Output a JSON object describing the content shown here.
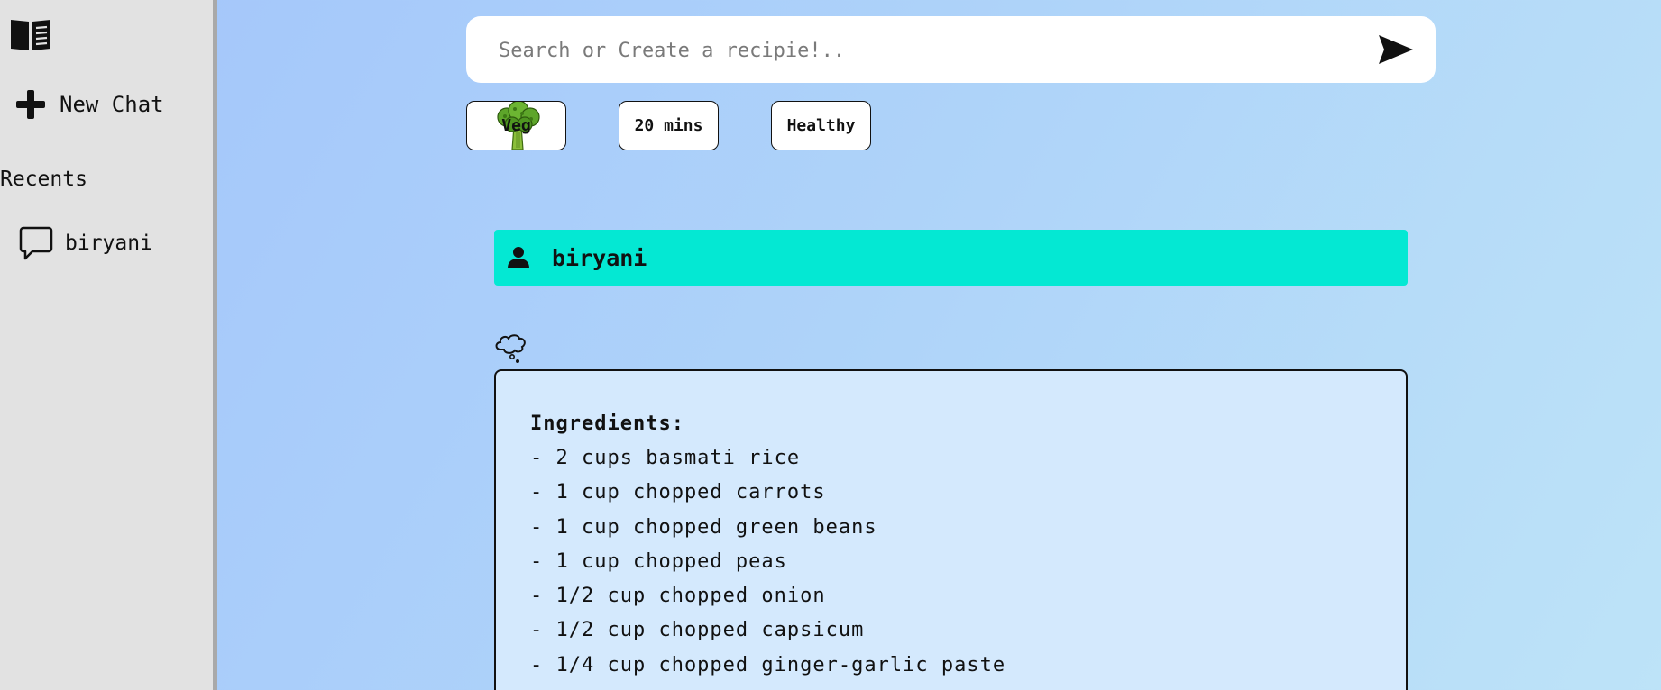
{
  "sidebar": {
    "logo_icon": "open-book-icon",
    "new_chat_label": "New Chat",
    "recents_title": "Recents",
    "recents": [
      {
        "label": "biryani",
        "icon": "chat-bubble-icon"
      }
    ]
  },
  "search": {
    "placeholder": "Search or Create a recipie!..",
    "value": "",
    "send_icon": "send-arrow-icon"
  },
  "filters": [
    {
      "label": "Veg",
      "icon": "broccoli-icon"
    },
    {
      "label": "20 mins"
    },
    {
      "label": "Healthy"
    }
  ],
  "conversation": {
    "user_message": "biryani",
    "user_icon": "person-icon",
    "thinking_icon": "thought-bubble-icon",
    "response": {
      "heading": "Ingredients:",
      "lines": [
        "- 2 cups basmati rice",
        "- 1 cup chopped carrots",
        "- 1 cup chopped green beans",
        "- 1 cup chopped peas",
        "- 1/2 cup chopped onion",
        "- 1/2 cup chopped capsicum",
        "- 1/4 cup chopped ginger-garlic paste"
      ]
    }
  },
  "colors": {
    "sidebar_bg": "#e2e2e2",
    "user_message_bg": "#04e8d3",
    "response_bg": "#d4e9fd",
    "page_gradient_start": "#a3c5fb",
    "page_gradient_end": "#bde3f8"
  }
}
